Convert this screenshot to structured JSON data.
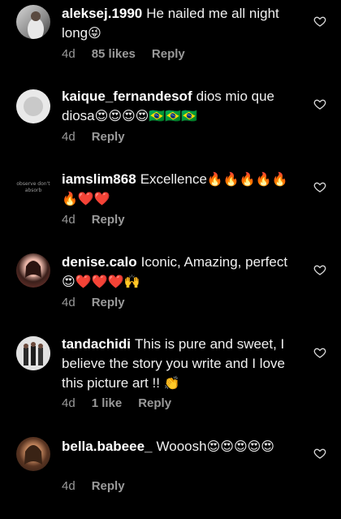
{
  "comments": [
    {
      "username": "aleksej.1990",
      "text": "He nailed me all night long",
      "emoji": "😜",
      "time": "4d",
      "likes": "85 likes",
      "reply": "Reply"
    },
    {
      "username": "kaique_fernandesof",
      "text": "dios mio que diosa",
      "emoji": "😍😍😍😍🇧🇷🇧🇷🇧🇷",
      "time": "4d",
      "likes": "",
      "reply": "Reply"
    },
    {
      "username": "iamslim868",
      "text": "Excellence",
      "emoji": "🔥🔥🔥🔥🔥🔥❤️❤️",
      "time": "4d",
      "likes": "",
      "reply": "Reply",
      "avatar_text": "observe don't absorb"
    },
    {
      "username": "denise.calo",
      "text": "Iconic, Amazing, perfect",
      "emoji": "😍❤️❤️❤️🙌",
      "time": "4d",
      "likes": "",
      "reply": "Reply"
    },
    {
      "username": "tandachidi",
      "text": "This is pure and sweet, I believe the story you write and I love this picture art !!",
      "emoji": "👏",
      "time": "4d",
      "likes": "1 like",
      "reply": "Reply"
    },
    {
      "username": "bella.babeee_",
      "text": "Wooosh",
      "emoji": "😍😍😍😍😍",
      "time": "4d",
      "likes": "",
      "reply": "Reply"
    }
  ],
  "colors": {
    "background": "#000000",
    "text": "#f0f0f0",
    "meta": "#9a9a9a"
  }
}
